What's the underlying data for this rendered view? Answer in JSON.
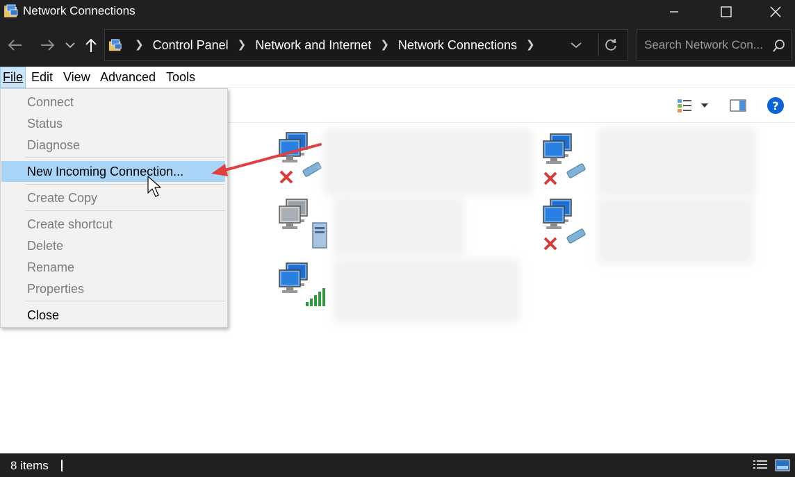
{
  "window": {
    "title": "Network Connections",
    "icon": "network-folder-icon"
  },
  "address_bar": {
    "crumbs": [
      "Control Panel",
      "Network and Internet",
      "Network Connections"
    ],
    "icon": "network-folder-icon"
  },
  "search": {
    "placeholder": "Search Network Con..."
  },
  "menu_bar": {
    "file": "File",
    "edit": "Edit",
    "view": "View",
    "advanced": "Advanced",
    "tools": "Tools"
  },
  "file_menu": {
    "connect": "Connect",
    "status": "Status",
    "diagnose": "Diagnose",
    "new_incoming": "New Incoming Connection...",
    "create_copy": "Create Copy",
    "create_shortcut": "Create shortcut",
    "delete": "Delete",
    "rename": "Rename",
    "properties": "Properties",
    "close": "Close"
  },
  "connections": [
    {
      "icon": "network-computers-icon",
      "status": "disconnected"
    },
    {
      "icon": "network-computers-icon",
      "status": "disconnected"
    },
    {
      "icon": "network-server-icon",
      "status": "connected"
    },
    {
      "icon": "network-computers-icon",
      "status": "disconnected"
    },
    {
      "icon": "wireless-network-icon",
      "status": "connected"
    }
  ],
  "status_bar": {
    "item_count": "8 items"
  },
  "colors": {
    "titlebar": "#202020",
    "menu_highlight": "#a8d4f8",
    "annotation_arrow": "#e04040",
    "help_blue": "#0a64d8"
  }
}
